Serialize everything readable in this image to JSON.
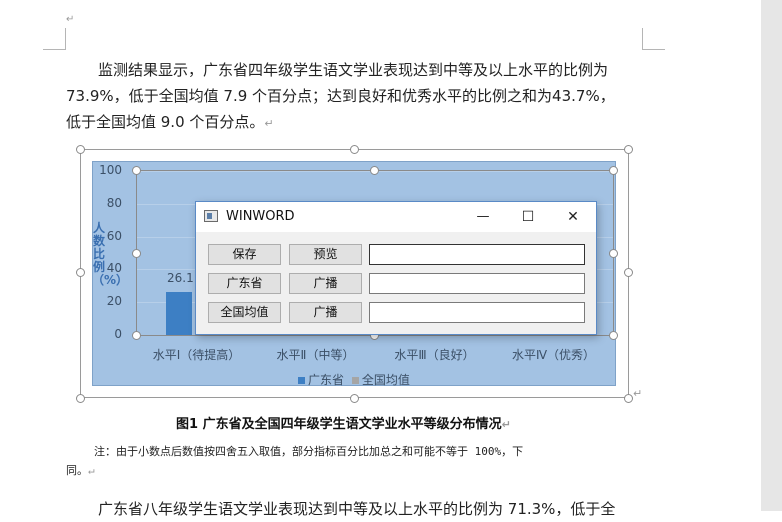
{
  "document": {
    "paragraph1": {
      "line1": "监测结果显示，广东省四年级学生语文学业表现达到中等及以上水平的比例为",
      "line2": "73.9%，低于全国均值 7.9 个百分点；达到良好和优秀水平的比例之和为43.7%，",
      "line3": "低于全国均值 9.0 个百分点。"
    },
    "figure_caption": "图1   广东省及全国四年级学生语文学业水平等级分布情况",
    "note_line1": "注：由于小数点后数值按四舍五入取值，部分指标百分比加总之和可能不等于 100%，下",
    "note_line2": "同。",
    "paragraph2_partial": "广东省八年级学生语文学业表现达到中等及以上水平的比例为 71.3%，低于全",
    "return_mark": "↵"
  },
  "chart_data": {
    "type": "bar",
    "categories": [
      "水平Ⅰ（待提高）",
      "水平Ⅱ（中等）",
      "水平Ⅲ（良好）",
      "水平Ⅳ（优秀）"
    ],
    "y_ticks": [
      "0",
      "20",
      "40",
      "60",
      "80",
      "100"
    ],
    "ylim": [
      0,
      100
    ],
    "ylabel": "人数比例（%）",
    "legend_placement": "bottom-center",
    "series": [
      {
        "name": "广东省",
        "color": "#3d7fc4",
        "values": [
          26.1
        ],
        "labels": [
          "26.1"
        ]
      },
      {
        "name": "全国均值",
        "color": "#a5a5a5",
        "values": [],
        "labels": []
      }
    ]
  },
  "dialog": {
    "title": "WINWORD",
    "minimize_glyph": "—",
    "maximize_glyph": "☐",
    "close_glyph": "✕",
    "rows": [
      {
        "left_label": "保存",
        "right_label": "预览",
        "value": ""
      },
      {
        "left_label": "广东省",
        "right_label": "广播",
        "value": ""
      },
      {
        "left_label": "全国均值",
        "right_label": "广播",
        "value": ""
      }
    ]
  }
}
